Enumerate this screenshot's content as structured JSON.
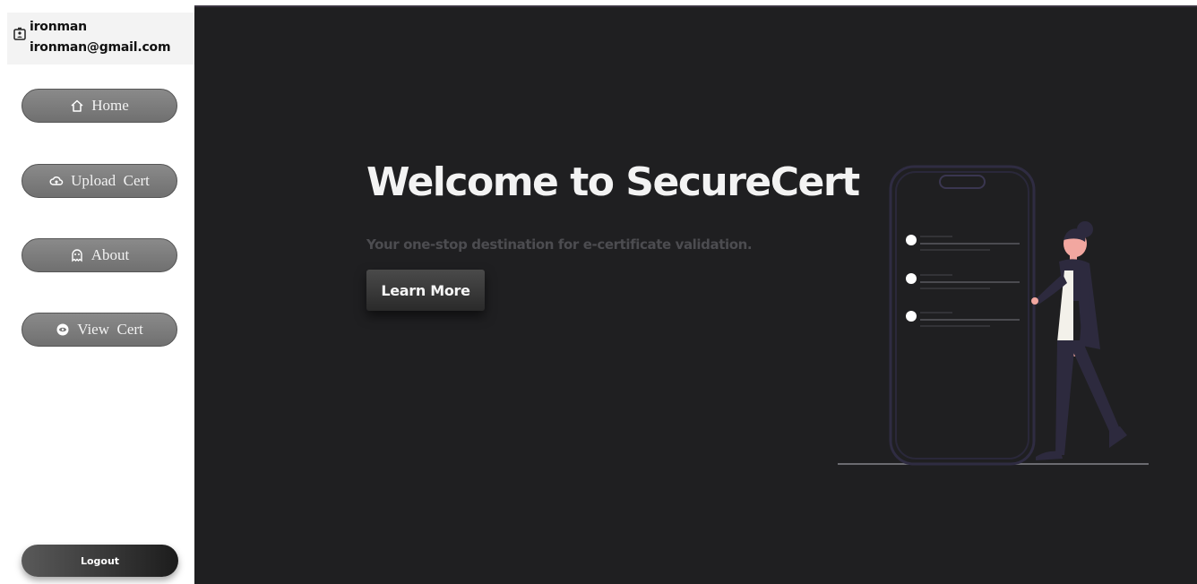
{
  "user": {
    "icon": "contact-card-icon",
    "name": "ironman",
    "email": "ironman@gmail.com"
  },
  "sidebar": {
    "items": [
      {
        "label": "Home",
        "icon": "home-icon"
      },
      {
        "label": "Upload  Cert",
        "icon": "cloud-upload-icon"
      },
      {
        "label": "About",
        "icon": "ghost-icon"
      },
      {
        "label": "View  Cert",
        "icon": "eye-badge-icon"
      }
    ],
    "logout_label": "Logout"
  },
  "hero": {
    "title": "Welcome to SecureCert",
    "subtitle": "Your one-stop destination for e-certificate validation.",
    "cta_label": "Learn More"
  },
  "colors": {
    "main_background": "#1f1f21",
    "sidebar_background": "#ffffff",
    "nav_button": "#7a7a7a",
    "illustration_accent": "#2d2a3e"
  }
}
